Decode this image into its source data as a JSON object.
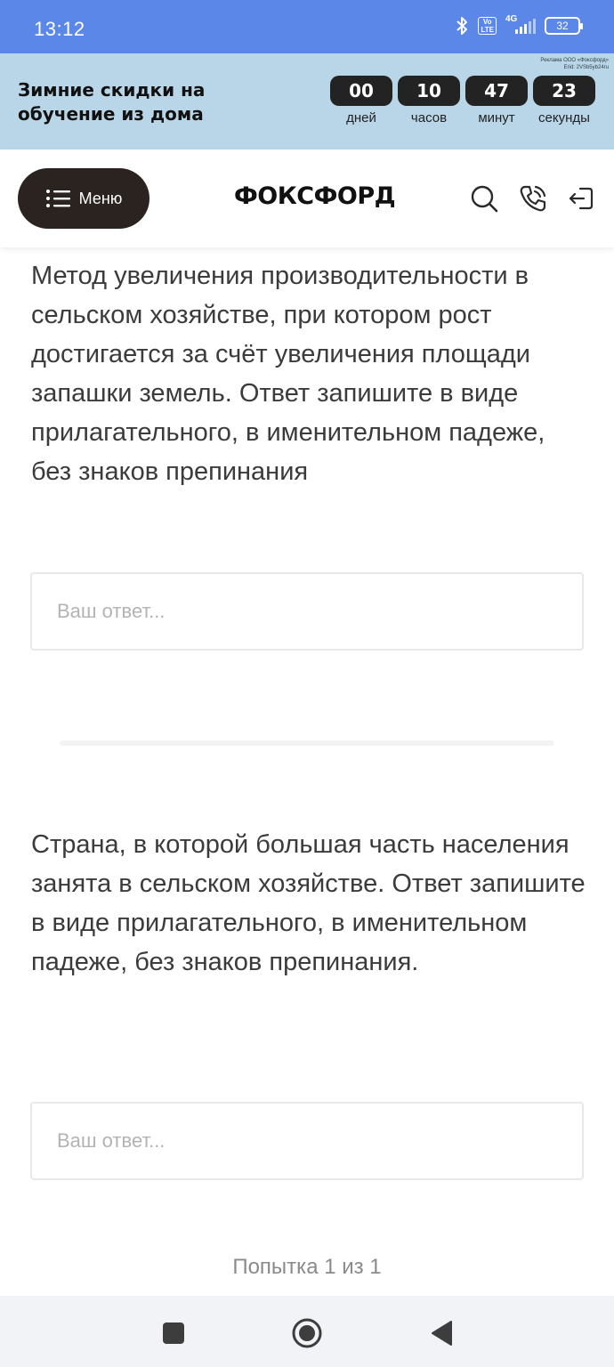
{
  "status_bar": {
    "time": "13:12",
    "volte": "Vo LTE",
    "network": "4G",
    "battery": "32"
  },
  "promo": {
    "ad_note_1": "Реклама ООО «Фоксфорд»",
    "ad_note_2": "Erid: 2VSb5yb24ru",
    "title": "Зимние скидки на обучение из дома",
    "timer": [
      {
        "value": "00",
        "unit": "дней"
      },
      {
        "value": "10",
        "unit": "часов"
      },
      {
        "value": "47",
        "unit": "минут"
      },
      {
        "value": "23",
        "unit": "секунды"
      }
    ]
  },
  "header": {
    "menu_label": "Меню",
    "logo": "ФОКСФОРД",
    "icons": [
      "search-icon",
      "phone-icon",
      "login-icon"
    ]
  },
  "questions": [
    {
      "text": "Метод увеличения производительности в сельском хозяйстве, при котором рост достигается за счёт увеличения площади запашки земель. Ответ запишите в виде прилагательного, в именительном падеже, без знаков препинания",
      "placeholder": "Ваш ответ...",
      "value": ""
    },
    {
      "text": "Страна, в которой большая часть населения занята в сельском хозяйстве. Ответ запишите в виде прилагательного, в именительном падеже, без знаков препинания.",
      "placeholder": "Ваш ответ...",
      "value": ""
    }
  ],
  "footer": {
    "attempt": "Попытка 1 из 1"
  },
  "nav": {
    "icons": [
      "recents-icon",
      "home-icon",
      "back-icon"
    ]
  },
  "colors": {
    "status_bar": "#5b87e8",
    "promo_bg": "#b9d6e8",
    "timer_box": "#232323",
    "menu_button": "#2a2320",
    "text": "#3b3b3b",
    "navbar": "#f1f3f6"
  }
}
